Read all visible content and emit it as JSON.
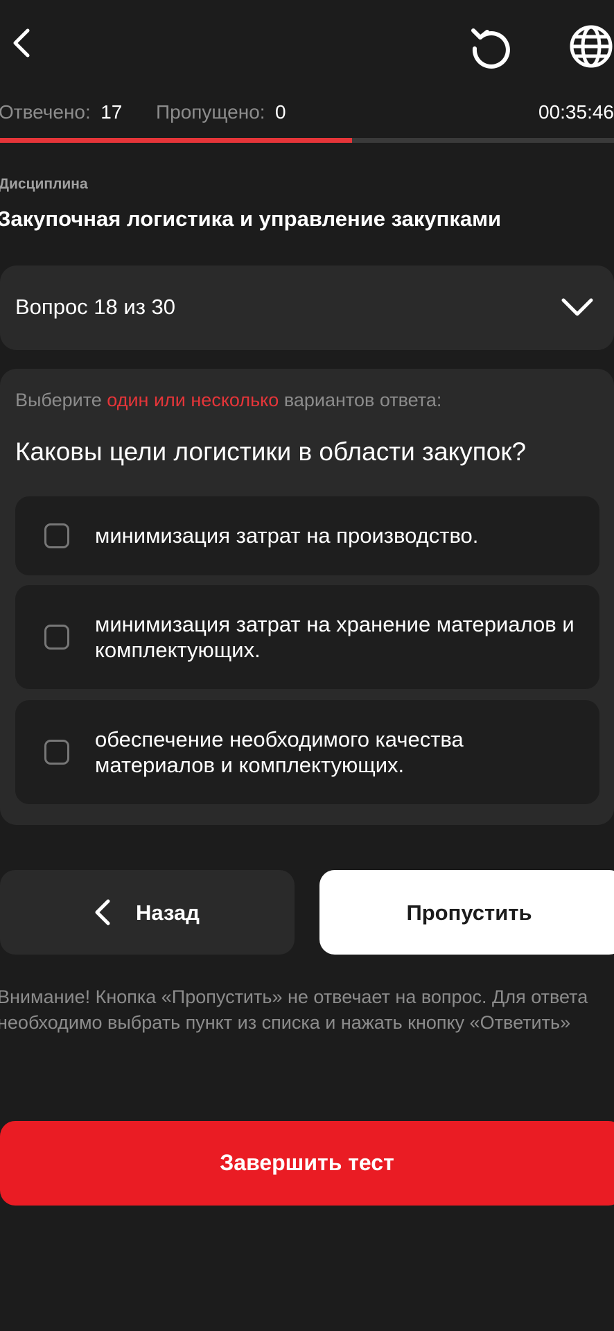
{
  "header": {
    "back_icon": "chevron-left-icon",
    "reset_icon": "reset-icon",
    "language_icon": "globe-icon"
  },
  "stats": {
    "answered_label": "Отвечено:",
    "answered_value": "17",
    "skipped_label": "Пропущено:",
    "skipped_value": "0",
    "timer": "00:35:46",
    "progress_fraction": 0.573
  },
  "discipline": {
    "label": "Дисциплина",
    "title": "Закупочная логистика и управление закупками"
  },
  "question_selector": {
    "label": "Вопрос 18 из 30"
  },
  "question": {
    "instruction_prefix": "Выберите",
    "instruction_highlight": "один или несколько",
    "instruction_suffix": "вариантов ответа:",
    "text": "Каковы цели логистики в области закупок?",
    "options": [
      {
        "label": "минимизация затрат на производство.",
        "checked": false
      },
      {
        "label": "минимизация затрат на хранение материалов и комплектующих.",
        "checked": false
      },
      {
        "label": "обеспечение необходимого качества материалов и комплектующих.",
        "checked": false
      }
    ]
  },
  "actions": {
    "back_label": "Назад",
    "skip_label": "Пропустить",
    "warning": "Внимание! Кнопка «Пропустить» не отвечает на вопрос. Для ответа необходимо выбрать пункт из списка и нажать кнопку «Ответить»",
    "finish_label": "Завершить тест"
  },
  "colors": {
    "background": "#1c1c1c",
    "card": "#2a2a2a",
    "accent_red": "#ea1c24",
    "progress_red": "#e53539",
    "muted_text": "#8c8c8c"
  }
}
